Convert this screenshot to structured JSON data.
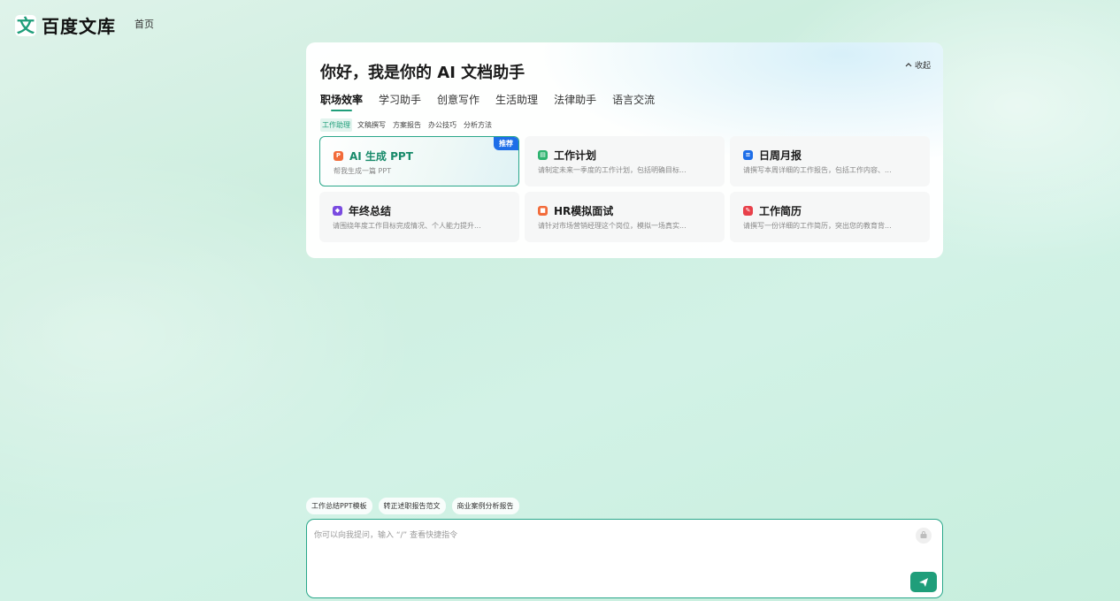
{
  "header": {
    "logo_mark": "文",
    "logo_text": "百度文库",
    "nav_home": "首页"
  },
  "panel": {
    "title": "你好，我是你的 AI 文档助手",
    "collapse_label": "收起",
    "main_tabs": [
      "职场效率",
      "学习助手",
      "创意写作",
      "生活助理",
      "法律助手",
      "语言交流"
    ],
    "active_main_tab": "职场效率",
    "sub_tabs": [
      "工作助理",
      "文稿撰写",
      "方案报告",
      "办公技巧",
      "分析方法"
    ],
    "active_sub_tab": "工作助理",
    "cards": [
      {
        "title": "AI 生成 PPT",
        "desc": "帮我生成一篇 PPT",
        "badge": "推荐",
        "icon": "ppt-icon",
        "color": "#f26b3a"
      },
      {
        "title": "工作计划",
        "desc": "请制定未来一季度的工作计划，包括明确目标...",
        "icon": "plan-icon",
        "color": "#2db36f"
      },
      {
        "title": "日周月报",
        "desc": "请撰写本周详细的工作报告，包括工作内容、...",
        "icon": "report-icon",
        "color": "#1e6ee8"
      },
      {
        "title": "年终总结",
        "desc": "请围绕年度工作目标完成情况、个人能力提升...",
        "icon": "summary-icon",
        "color": "#7a4be0"
      },
      {
        "title": "HR模拟面试",
        "desc": "请针对市场营销经理这个岗位，模拟一场真实...",
        "icon": "interview-icon",
        "color": "#f26b3a"
      },
      {
        "title": "工作简历",
        "desc": "请撰写一份详细的工作简历，突出您的教育背...",
        "icon": "resume-icon",
        "color": "#e8404a"
      }
    ]
  },
  "quick_chips": [
    "工作总结PPT模板",
    "转正述职报告范文",
    "商业案例分析报告"
  ],
  "input": {
    "placeholder": "你可以向我提问，输入 “/” 查看快捷指令",
    "value": ""
  },
  "colors": {
    "accent": "#1f9e7a",
    "badge": "#1e6ee8"
  }
}
